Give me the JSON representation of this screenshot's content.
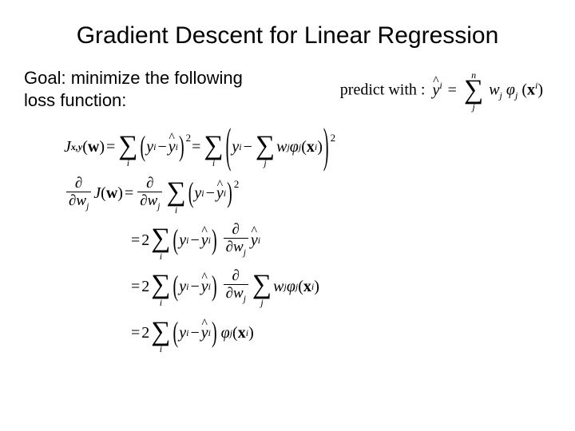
{
  "title": "Gradient Descent for Linear Regression",
  "goal": "Goal: minimize the following loss function:",
  "predict": {
    "label": "predict with :",
    "yhat": "y",
    "yhat_sup": "i",
    "eq": "=",
    "sum_above": "n",
    "sum_below": "j",
    "w": "w",
    "w_sub": "j",
    "phi": "φ",
    "phi_sub": "j",
    "x": "x",
    "x_sup": "i"
  },
  "loss": {
    "J": "J",
    "J_sub": "x,y",
    "w": "w",
    "eq": "=",
    "sum_below_i": "i",
    "y": "y",
    "y_sup": "i",
    "minus": "−",
    "yhat": "y",
    "yhat_sup": "i",
    "exp2": "2",
    "sum_below_j": "j",
    "wj": "w",
    "wj_sub": "j",
    "phi": "φ",
    "phi_sub": "j",
    "x": "x",
    "x_sup": "i"
  },
  "deriv": {
    "partial": "∂",
    "w": "w",
    "w_sub": "j",
    "J": "J",
    "arg": "w",
    "eq": "=",
    "sum_below": "i",
    "y": "y",
    "y_sup": "i",
    "minus": "−",
    "yhat": "y",
    "yhat_sup": "i",
    "exp2": "2"
  },
  "step2": {
    "eq": "=",
    "two": "2",
    "sum_below": "i",
    "y": "y",
    "y_sup": "i",
    "minus": "−",
    "yhat": "y",
    "yhat_sup": "i",
    "partial": "∂",
    "w": "w",
    "w_sub": "j",
    "yhat2": "y",
    "yhat2_sup": "i"
  },
  "step3": {
    "eq": "=",
    "two": "2",
    "sum_below_i": "i",
    "y": "y",
    "y_sup": "i",
    "minus": "−",
    "yhat": "y",
    "yhat_sup": "i",
    "partial": "∂",
    "w": "w",
    "w_sub": "j",
    "sum_below_j": "j",
    "wj": "w",
    "wj_sub": "j",
    "phi": "φ",
    "phi_sub": "j",
    "x": "x",
    "x_sup": "i"
  },
  "step4": {
    "eq": "=",
    "two": "2",
    "sum_below": "i",
    "y": "y",
    "y_sup": "i",
    "minus": "−",
    "yhat": "y",
    "yhat_sup": "i",
    "phi": "φ",
    "phi_sub": "j",
    "x": "x",
    "x_sup": "i"
  }
}
